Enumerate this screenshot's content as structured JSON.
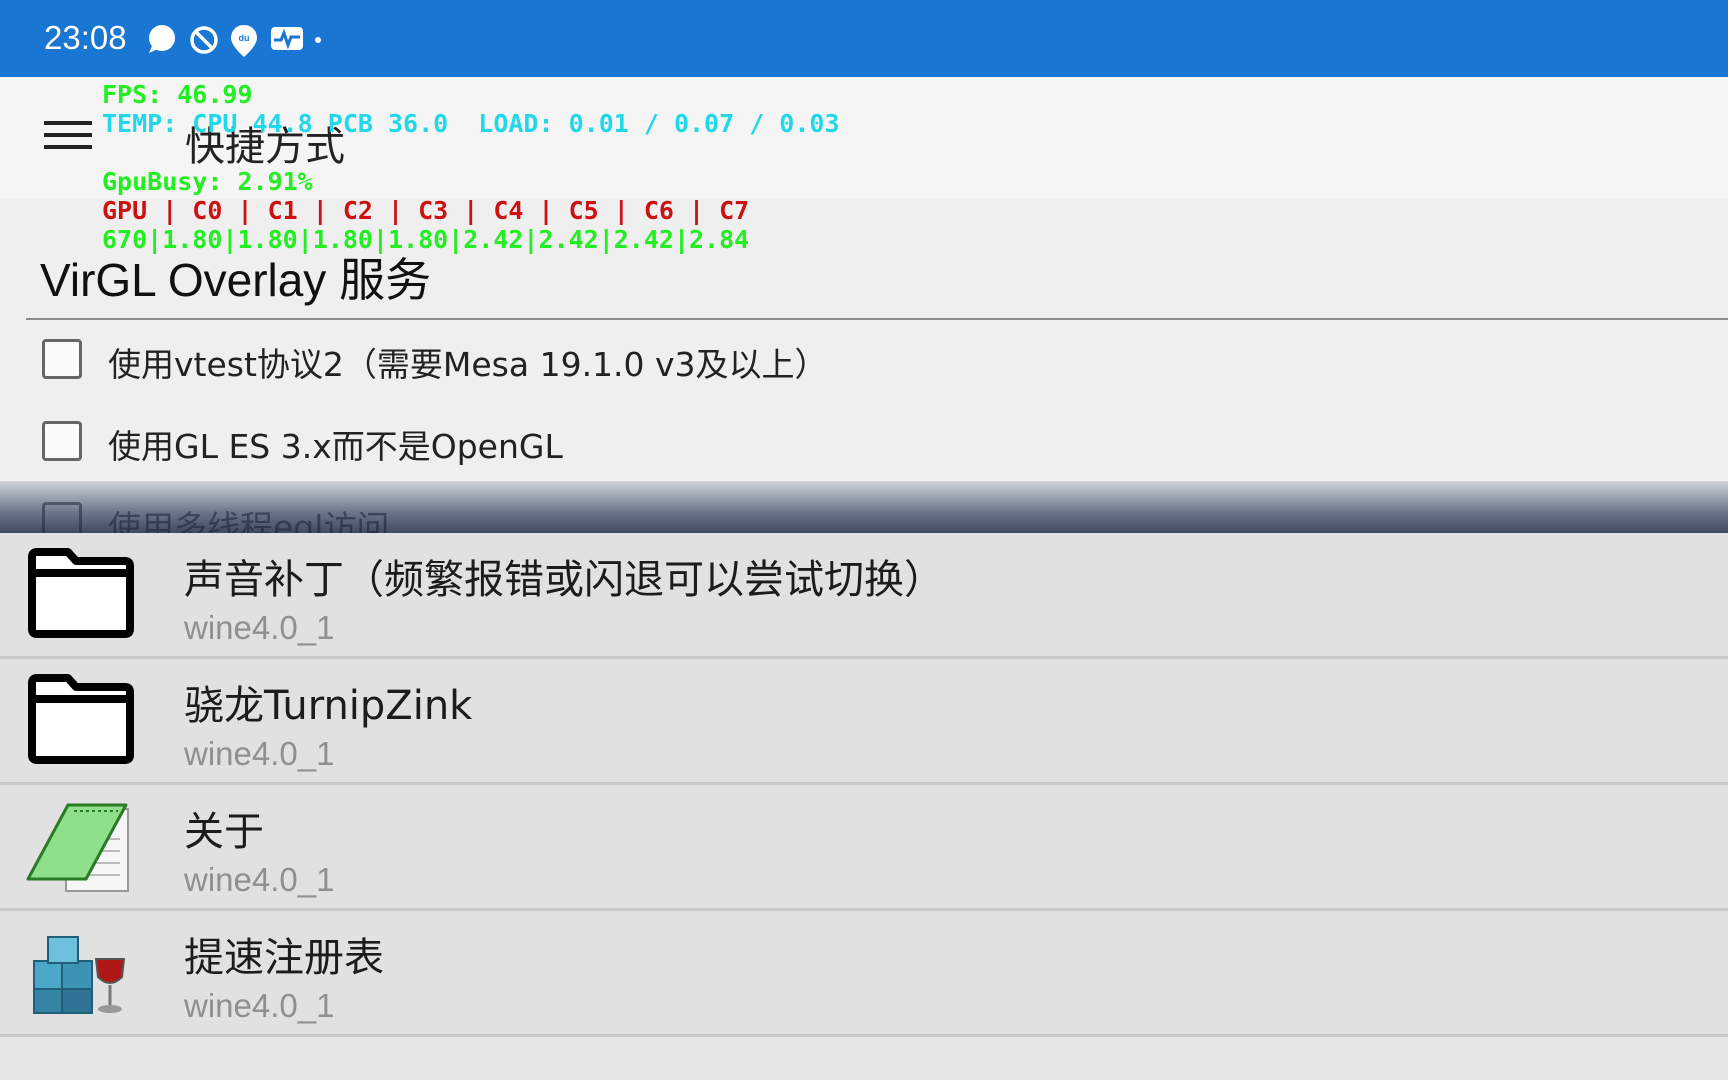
{
  "status_bar": {
    "time": "23:08",
    "icons": [
      "chat-bubble-icon",
      "do-not-disturb-icon",
      "location-du-icon",
      "activity-monitor-icon",
      "more-dot-icon"
    ],
    "background": "#1976d2"
  },
  "toolbar": {
    "menu_icon": "hamburger-menu-icon",
    "title": "快捷方式"
  },
  "perf_overlay": {
    "fps": "FPS: 46.99",
    "temp": "TEMP: CPU 44.8 PCB 36.0  LOAD: 0.01 / 0.07 / 0.03",
    "gpu_busy": "GpuBusy: 2.91%",
    "freq_header": "GPU | C0 | C1 | C2 | C3 | C4 | C5 | C6 | C7",
    "freq_values": "670|1.80|1.80|1.80|1.80|2.42|2.42|2.42|2.84",
    "colors": {
      "fps": "#22ee22",
      "temp": "#22d8e8",
      "gpu_busy": "#22ee22",
      "freq_header": "#cc1111",
      "freq_values": "#22ee22"
    }
  },
  "settings": {
    "title": "VirGL Overlay 服务",
    "options": [
      {
        "label": "使用vtest协议2（需要Mesa 19.1.0 v3及以上）",
        "checked": false
      },
      {
        "label": "使用GL ES 3.x而不是OpenGL",
        "checked": false
      },
      {
        "label": "使用多线程egl访问",
        "checked": false
      }
    ]
  },
  "shortcuts": [
    {
      "name": "声音补丁（频繁报错或闪退可以尝试切换）",
      "subtitle": "wine4.0_1",
      "icon": "folder-icon"
    },
    {
      "name": "骁龙TurnipZink",
      "subtitle": "wine4.0_1",
      "icon": "folder-icon"
    },
    {
      "name": "关于",
      "subtitle": "wine4.0_1",
      "icon": "notepad-icon"
    },
    {
      "name": "提速注册表",
      "subtitle": "wine4.0_1",
      "icon": "regedit-wine-icon"
    }
  ]
}
